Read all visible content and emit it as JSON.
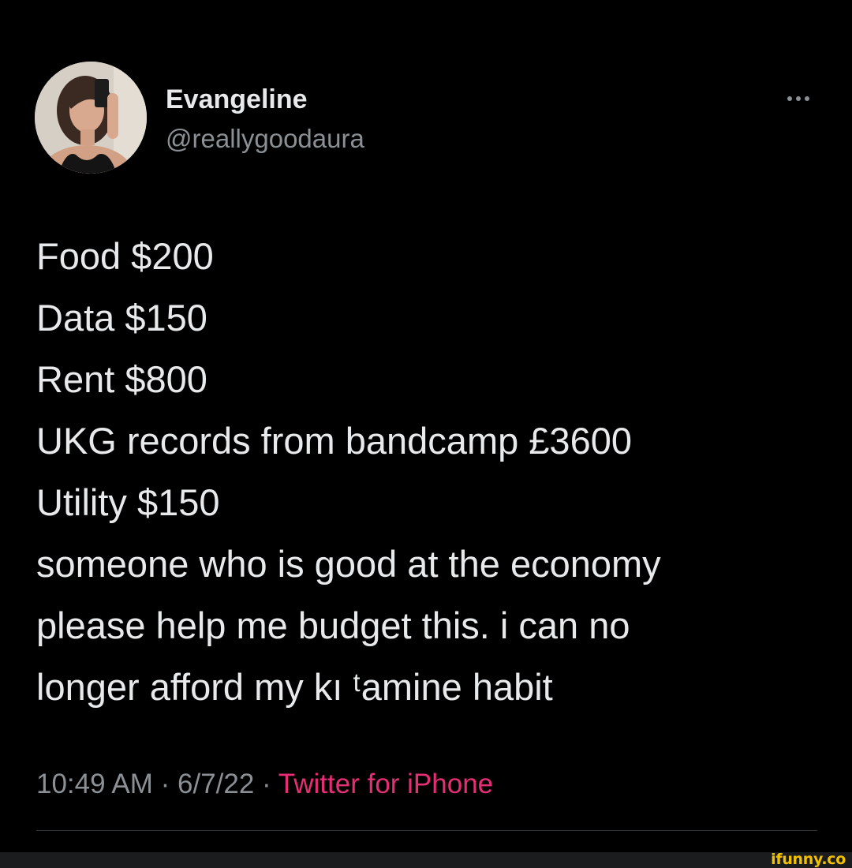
{
  "user": {
    "display_name": "Evangeline",
    "handle": "@reallygoodaura",
    "avatar_icon": "profile-photo"
  },
  "more_icon": "ellipsis-icon",
  "tweet": {
    "lines": [
      "Food $200",
      "Data $150",
      "Rent $800",
      "UKG records from bandcamp £3600",
      "Utility $150",
      "someone who is good at the economy",
      "please help me budget this. i can no",
      "longer afford my kı ᵗamine habit"
    ]
  },
  "meta": {
    "time": "10:49 AM",
    "separator": " · ",
    "date": "6/7/22",
    "source": "Twitter for iPhone"
  },
  "colors": {
    "background": "#000000",
    "text": "#e7e9ea",
    "muted": "#8b9095",
    "source_link": "#e62e74",
    "watermark": "#f2c200"
  },
  "watermark": "ifunny.co"
}
